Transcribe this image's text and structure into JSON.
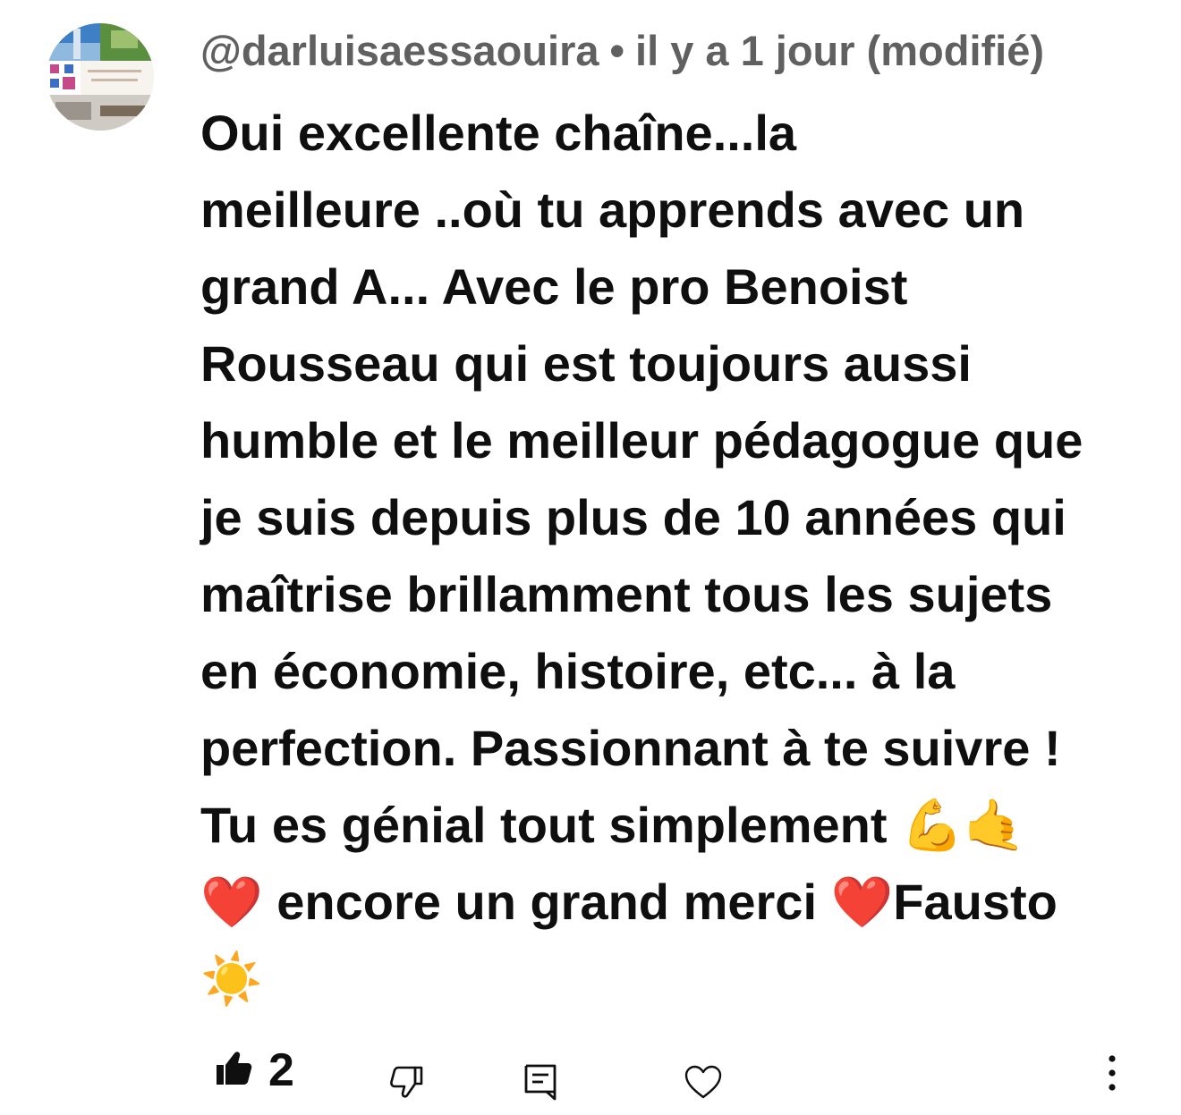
{
  "comment": {
    "author": "@darluisaessaouira",
    "separator": "•",
    "time": "il y a 1 jour (modifié)",
    "text": "Oui excellente chaîne...la\nmeilleure ..où tu apprends avec un\ngrand A... Avec le pro Benoist\nRousseau qui est toujours aussi\nhumble et le meilleur pédagogue que\nje suis depuis plus de 10 années qui\nmaîtrise brillamment tous les sujets\nen économie, histoire, etc... à la\nperfection. Passionnant à te suivre !\nTu es génial tout simplement 💪🤙\n❤️ encore un grand merci ❤️Fausto\n☀️"
  },
  "actions": {
    "like_count": "2",
    "like_icon": "thumbs-up-icon",
    "dislike_icon": "thumbs-down-icon",
    "reply_icon": "reply-comment-icon",
    "heart_icon": "heart-icon",
    "more_icon": "more-vertical-icon"
  },
  "colors": {
    "meta_text": "#606060",
    "body_text": "#0f0f0f",
    "icon": "#0f0f0f",
    "background": "#ffffff"
  }
}
